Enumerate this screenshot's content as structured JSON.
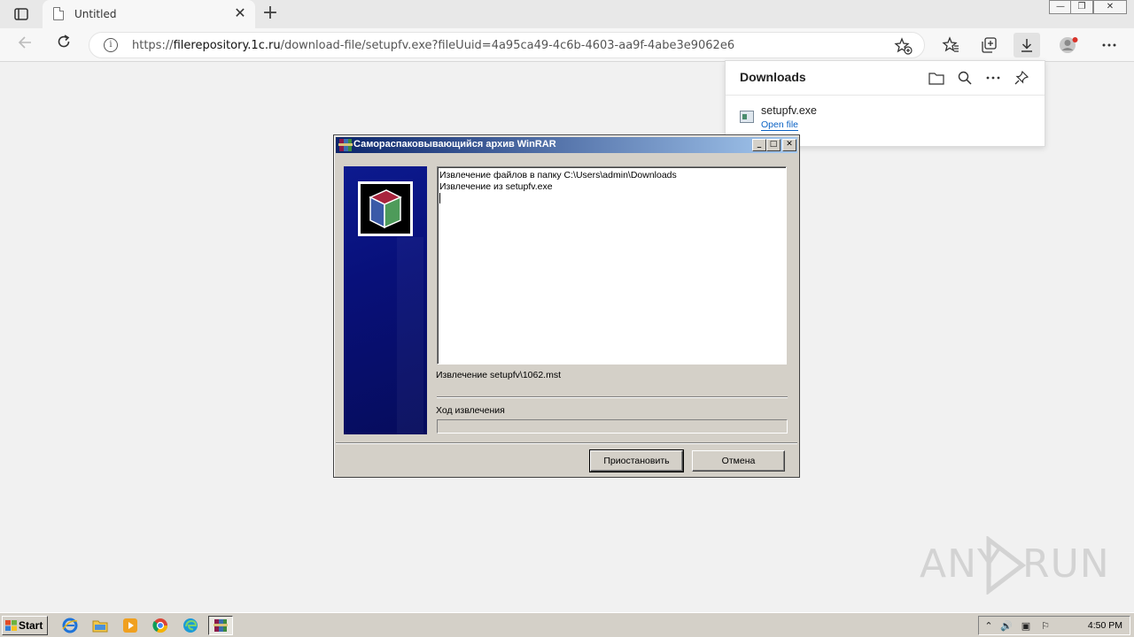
{
  "browser": {
    "tab": {
      "title": "Untitled",
      "close_glyph": "✕"
    },
    "new_tab_glyph": "+",
    "address": {
      "prefix": "https://",
      "domain": "filerepository.1c.ru",
      "path": "/download-file/setupfv.exe?fileUuid=4a95ca49-4c6b-4603-aa9f-4abe3e9062e6"
    },
    "downloads_panel": {
      "title": "Downloads",
      "items": [
        {
          "name": "setupfv.exe",
          "action": "Open file"
        }
      ]
    }
  },
  "dialog": {
    "title": "Самораспаковывающийся архив WinRAR",
    "log_lines": [
      "Извлечение файлов в папку C:\\Users\\admin\\Downloads",
      "Извлечение из setupfv.exe"
    ],
    "status": "Извлечение setupfv\\1062.mst",
    "progress_label": "Ход извлечения",
    "progress": 0,
    "buttons": {
      "pause": "Приостановить",
      "cancel": "Отмена"
    },
    "caption_buttons": {
      "minimize": "_",
      "maximize": "□",
      "close": "✕"
    }
  },
  "watermark": {
    "left": "ANY",
    "right": "RUN"
  },
  "taskbar": {
    "start_label": "Start",
    "clock": "4:50 PM",
    "pinned": [
      "internet-explorer-icon",
      "file-explorer-icon",
      "media-player-icon",
      "chrome-icon",
      "edge-icon",
      "winrar-icon"
    ]
  },
  "colors": {
    "titlebar_start": "#0a246a",
    "titlebar_end": "#a6caf0",
    "link": "#0b62c4",
    "dialog_face": "#d4d0c8"
  }
}
